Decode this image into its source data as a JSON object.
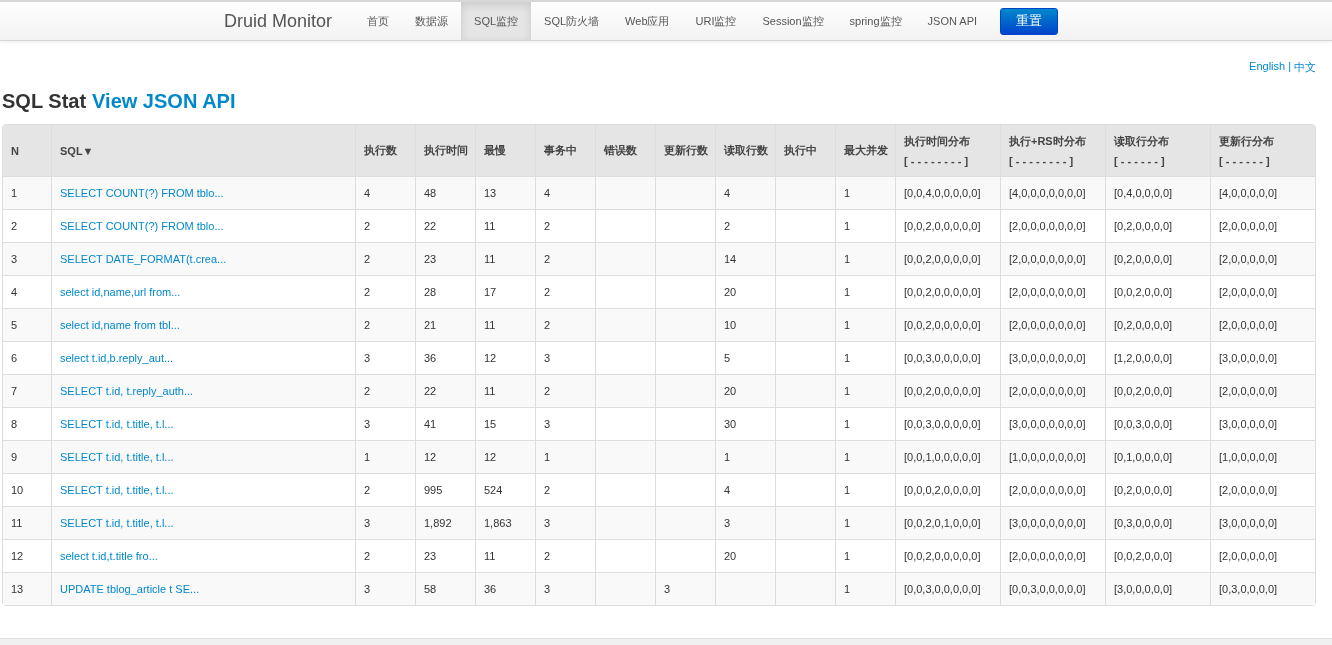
{
  "navbar": {
    "brand": "Druid Monitor",
    "tabs": [
      {
        "label": "首页",
        "selected": false
      },
      {
        "label": "数据源",
        "selected": false
      },
      {
        "label": "SQL监控",
        "selected": true
      },
      {
        "label": "SQL防火墙",
        "selected": false
      },
      {
        "label": "Web应用",
        "selected": false
      },
      {
        "label": "URI监控",
        "selected": false
      },
      {
        "label": "Session监控",
        "selected": false
      },
      {
        "label": "spring监控",
        "selected": false
      },
      {
        "label": "JSON API",
        "selected": false
      }
    ],
    "reset_button": "重置"
  },
  "language": {
    "options": [
      {
        "label": "English"
      },
      {
        "label": "中文"
      }
    ],
    "separator": "|"
  },
  "heading": {
    "title": "SQL Stat",
    "link": "View JSON API"
  },
  "table": {
    "columns": [
      {
        "label": "N"
      },
      {
        "label": "SQL▼"
      },
      {
        "label": "执行数"
      },
      {
        "label": "执行时间"
      },
      {
        "label": "最慢"
      },
      {
        "label": "事务中"
      },
      {
        "label": "错误数"
      },
      {
        "label": "更新行数"
      },
      {
        "label": "读取行数"
      },
      {
        "label": "执行中"
      },
      {
        "label": "最大并发"
      },
      {
        "label": "执行时间分布",
        "sublabel": "[ - - - - - - - - ]"
      },
      {
        "label": "执行+RS时分布",
        "sublabel": "[ - - - - - - - - ]"
      },
      {
        "label": "读取行分布",
        "sublabel": "[ - - - - - - ]"
      },
      {
        "label": "更新行分布",
        "sublabel": "[ - - - - - - ]"
      }
    ],
    "rows": [
      [
        "1",
        "SELECT COUNT(?) FROM tblo...",
        "4",
        "48",
        "13",
        "4",
        null,
        null,
        "4",
        null,
        "1",
        "[0,0,4,0,0,0,0,0]",
        "[4,0,0,0,0,0,0,0]",
        "[0,4,0,0,0,0]",
        "[4,0,0,0,0,0]"
      ],
      [
        "2",
        "SELECT COUNT(?) FROM tblo...",
        "2",
        "22",
        "11",
        "2",
        null,
        null,
        "2",
        null,
        "1",
        "[0,0,2,0,0,0,0,0]",
        "[2,0,0,0,0,0,0,0]",
        "[0,2,0,0,0,0]",
        "[2,0,0,0,0,0]"
      ],
      [
        "3",
        "SELECT DATE_FORMAT(t.crea...",
        "2",
        "23",
        "11",
        "2",
        null,
        null,
        "14",
        null,
        "1",
        "[0,0,2,0,0,0,0,0]",
        "[2,0,0,0,0,0,0,0]",
        "[0,2,0,0,0,0]",
        "[2,0,0,0,0,0]"
      ],
      [
        "4",
        "select id,name,url from...",
        "2",
        "28",
        "17",
        "2",
        null,
        null,
        "20",
        null,
        "1",
        "[0,0,2,0,0,0,0,0]",
        "[2,0,0,0,0,0,0,0]",
        "[0,0,2,0,0,0]",
        "[2,0,0,0,0,0]"
      ],
      [
        "5",
        "select id,name from tbl...",
        "2",
        "21",
        "11",
        "2",
        null,
        null,
        "10",
        null,
        "1",
        "[0,0,2,0,0,0,0,0]",
        "[2,0,0,0,0,0,0,0]",
        "[0,2,0,0,0,0]",
        "[2,0,0,0,0,0]"
      ],
      [
        "6",
        "select t.id,b.reply_aut...",
        "3",
        "36",
        "12",
        "3",
        null,
        null,
        "5",
        null,
        "1",
        "[0,0,3,0,0,0,0,0]",
        "[3,0,0,0,0,0,0,0]",
        "[1,2,0,0,0,0]",
        "[3,0,0,0,0,0]"
      ],
      [
        "7",
        "SELECT t.id, t.reply_auth...",
        "2",
        "22",
        "11",
        "2",
        null,
        null,
        "20",
        null,
        "1",
        "[0,0,2,0,0,0,0,0]",
        "[2,0,0,0,0,0,0,0]",
        "[0,0,2,0,0,0]",
        "[2,0,0,0,0,0]"
      ],
      [
        "8",
        "SELECT t.id, t.title, t.l...",
        "3",
        "41",
        "15",
        "3",
        null,
        null,
        "30",
        null,
        "1",
        "[0,0,3,0,0,0,0,0]",
        "[3,0,0,0,0,0,0,0]",
        "[0,0,3,0,0,0]",
        "[3,0,0,0,0,0]"
      ],
      [
        "9",
        "SELECT t.id, t.title, t.l...",
        "1",
        "12",
        "12",
        "1",
        null,
        null,
        "1",
        null,
        "1",
        "[0,0,1,0,0,0,0,0]",
        "[1,0,0,0,0,0,0,0]",
        "[0,1,0,0,0,0]",
        "[1,0,0,0,0,0]"
      ],
      [
        "10",
        "SELECT t.id, t.title, t.l...",
        "2",
        "995",
        "524",
        "2",
        null,
        null,
        "4",
        null,
        "1",
        "[0,0,0,2,0,0,0,0]",
        "[2,0,0,0,0,0,0,0]",
        "[0,2,0,0,0,0]",
        "[2,0,0,0,0,0]"
      ],
      [
        "11",
        "SELECT t.id, t.title, t.l...",
        "3",
        "1,892",
        "1,863",
        "3",
        null,
        null,
        "3",
        null,
        "1",
        "[0,0,2,0,1,0,0,0]",
        "[3,0,0,0,0,0,0,0]",
        "[0,3,0,0,0,0]",
        "[3,0,0,0,0,0]"
      ],
      [
        "12",
        "select t.id,t.title fro...",
        "2",
        "23",
        "11",
        "2",
        null,
        null,
        "20",
        null,
        "1",
        "[0,0,2,0,0,0,0,0]",
        "[2,0,0,0,0,0,0,0]",
        "[0,0,2,0,0,0]",
        "[2,0,0,0,0,0]"
      ],
      [
        "13",
        "UPDATE tblog_article t SE...",
        "3",
        "58",
        "36",
        "3",
        null,
        "3",
        null,
        null,
        "1",
        "[0,0,3,0,0,0,0,0]",
        "[0,0,3,0,0,0,0,0]",
        "[3,0,0,0,0,0]",
        "[0,3,0,0,0,0]"
      ]
    ]
  }
}
